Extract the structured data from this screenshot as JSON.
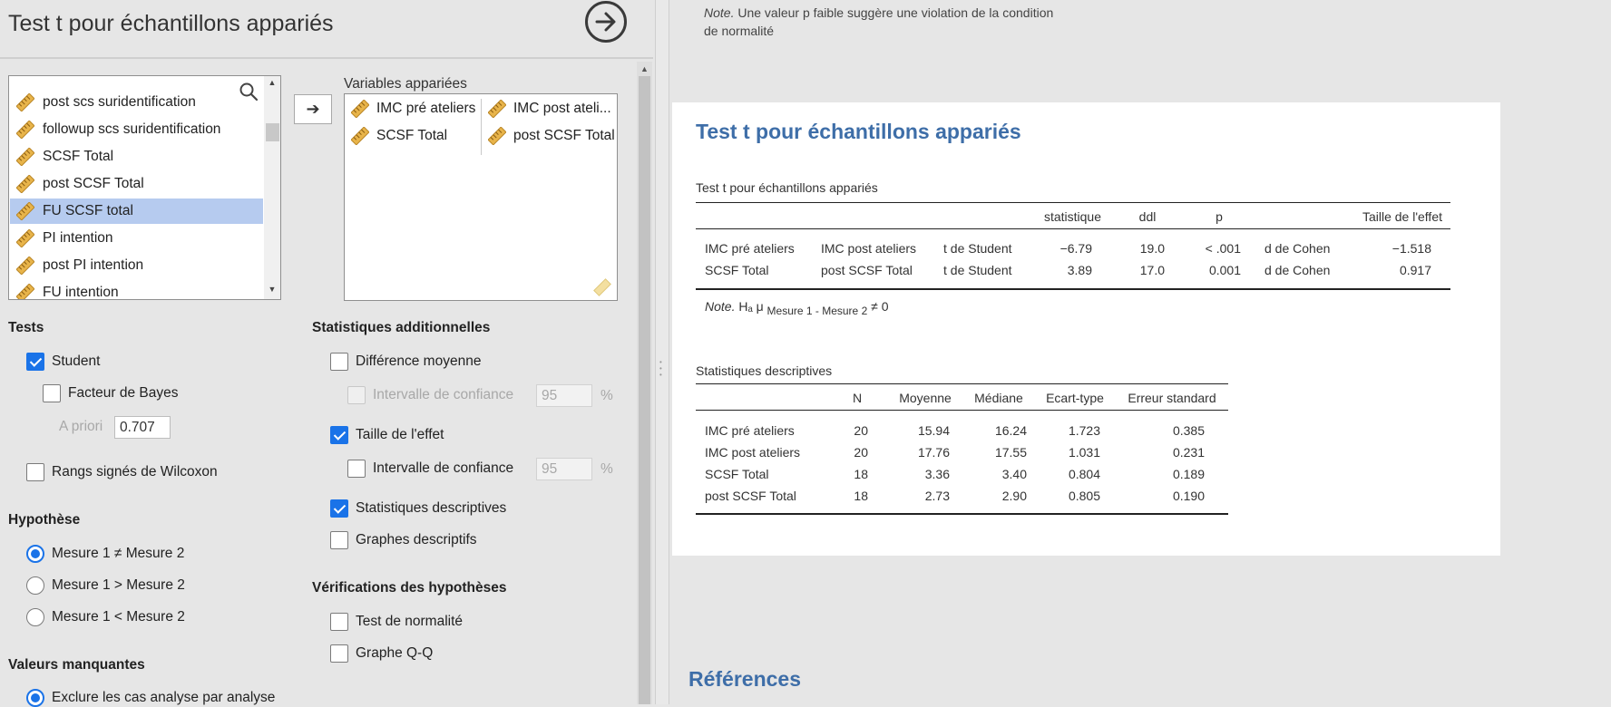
{
  "panel": {
    "title": "Test t pour échantillons appariés",
    "run_icon": "arrow-right-circle-icon"
  },
  "variables": [
    {
      "name": "post scs suridentification"
    },
    {
      "name": "followup scs suridentification"
    },
    {
      "name": "SCSF Total"
    },
    {
      "name": "post SCSF Total"
    },
    {
      "name": "FU SCSF total",
      "selected": true
    },
    {
      "name": "PI intention"
    },
    {
      "name": "post PI intention"
    },
    {
      "name": "FU intention"
    }
  ],
  "paired": {
    "label": "Variables appariées",
    "pairs": [
      {
        "left": "IMC pré ateliers",
        "right": "IMC post ateli..."
      },
      {
        "left": "SCSF Total",
        "right": "post SCSF Total"
      }
    ]
  },
  "tests": {
    "heading": "Tests",
    "student": "Student",
    "bayes": "Facteur de Bayes",
    "prior_label": "A priori",
    "prior_value": "0.707",
    "wilcoxon": "Rangs signés de Wilcoxon"
  },
  "hypothesis": {
    "heading": "Hypothèse",
    "options": [
      "Mesure 1 ≠ Mesure 2",
      "Mesure 1 > Mesure 2",
      "Mesure 1 < Mesure 2"
    ]
  },
  "missing": {
    "heading": "Valeurs manquantes",
    "option": "Exclure les cas analyse par analyse"
  },
  "additional": {
    "heading": "Statistiques additionnelles",
    "mean_diff": "Différence moyenne",
    "ci_label": "Intervalle de confiance",
    "ci_value": "95",
    "pct": "%",
    "effect_size": "Taille de l'effet",
    "ci2_label": "Intervalle de confiance",
    "ci2_value": "95",
    "descriptives": "Statistiques descriptives",
    "desc_plots": "Graphes descriptifs"
  },
  "assumptions": {
    "heading": "Vérifications des hypothèses",
    "normality": "Test de normalité",
    "qq": "Graphe Q-Q"
  },
  "results": {
    "top_note_prefix": "Note.",
    "top_note_text": " Une valeur p faible suggère une violation de la condition de normalité",
    "title": "Test t pour échantillons appariés",
    "ttest": {
      "caption": "Test t pour échantillons appariés",
      "headers": [
        "statistique",
        "ddl",
        "p",
        "Taille de l'effet"
      ],
      "rows": [
        [
          "IMC pré ateliers",
          "IMC post ateliers",
          "t de Student",
          "−6.79",
          "19.0",
          "< .001",
          "d de Cohen",
          "−1.518"
        ],
        [
          "SCSF Total",
          "post SCSF Total",
          "t de Student",
          "3.89",
          "17.0",
          "0.001",
          "d de Cohen",
          "0.917"
        ]
      ],
      "note_prefix": "Note.",
      "note_h": "Hₐ μ",
      "note_sub": "Mesure 1 - Mesure 2",
      "note_end": "≠ 0"
    },
    "descriptives": {
      "caption": "Statistiques descriptives",
      "headers": [
        "N",
        "Moyenne",
        "Médiane",
        "Ecart-type",
        "Erreur standard"
      ],
      "rows": [
        [
          "IMC pré ateliers",
          "20",
          "15.94",
          "16.24",
          "1.723",
          "0.385"
        ],
        [
          "IMC post ateliers",
          "20",
          "17.76",
          "17.55",
          "1.031",
          "0.231"
        ],
        [
          "SCSF Total",
          "18",
          "3.36",
          "3.40",
          "0.804",
          "0.189"
        ],
        [
          "post SCSF Total",
          "18",
          "2.73",
          "2.90",
          "0.805",
          "0.190"
        ]
      ]
    },
    "references_title": "Références"
  }
}
